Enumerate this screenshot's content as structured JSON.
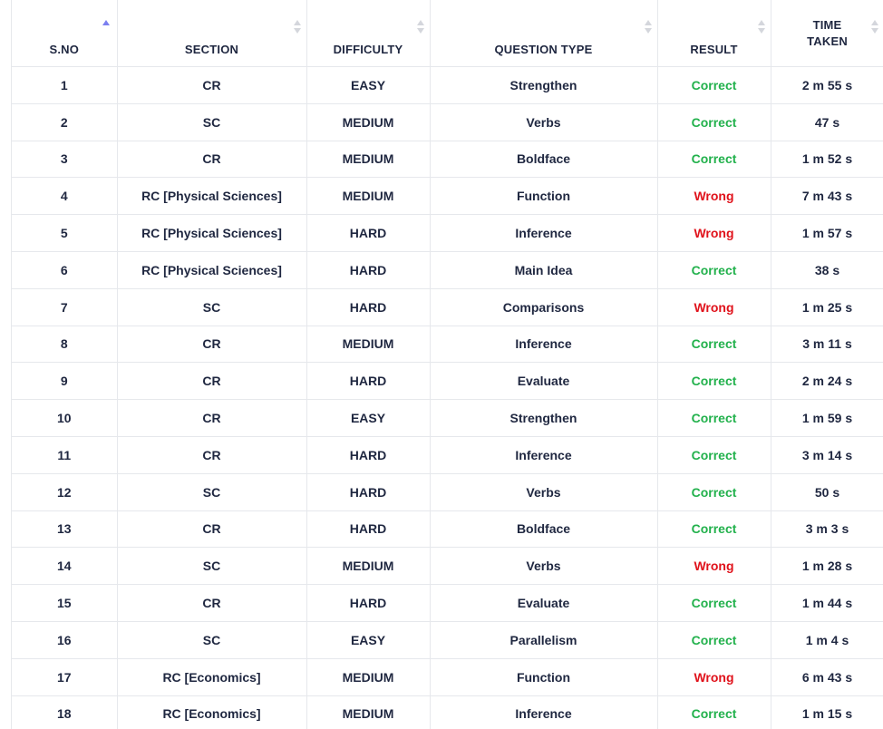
{
  "table": {
    "headers": {
      "sno": "S.NO",
      "section": "SECTION",
      "difficulty": "DIFFICULTY",
      "question_type": "QUESTION TYPE",
      "result": "RESULT",
      "time_line1": "TIME",
      "time_line2": "TAKEN"
    },
    "sort": {
      "column": "sno",
      "direction": "ascending"
    },
    "colors": {
      "correct": "#22b14c",
      "wrong": "#e0121b",
      "sort_active": "#7b7ff0"
    },
    "rows": [
      {
        "sno": "1",
        "section": "CR",
        "difficulty": "EASY",
        "qtype": "Strengthen",
        "result": "Correct",
        "time": "2 m 55 s"
      },
      {
        "sno": "2",
        "section": "SC",
        "difficulty": "MEDIUM",
        "qtype": "Verbs",
        "result": "Correct",
        "time": "47 s"
      },
      {
        "sno": "3",
        "section": "CR",
        "difficulty": "MEDIUM",
        "qtype": "Boldface",
        "result": "Correct",
        "time": "1 m 52 s"
      },
      {
        "sno": "4",
        "section": "RC [Physical Sciences]",
        "difficulty": "MEDIUM",
        "qtype": "Function",
        "result": "Wrong",
        "time": "7 m 43 s"
      },
      {
        "sno": "5",
        "section": "RC [Physical Sciences]",
        "difficulty": "HARD",
        "qtype": "Inference",
        "result": "Wrong",
        "time": "1 m 57 s"
      },
      {
        "sno": "6",
        "section": "RC [Physical Sciences]",
        "difficulty": "HARD",
        "qtype": "Main Idea",
        "result": "Correct",
        "time": "38 s"
      },
      {
        "sno": "7",
        "section": "SC",
        "difficulty": "HARD",
        "qtype": "Comparisons",
        "result": "Wrong",
        "time": "1 m 25 s"
      },
      {
        "sno": "8",
        "section": "CR",
        "difficulty": "MEDIUM",
        "qtype": "Inference",
        "result": "Correct",
        "time": "3 m 11 s"
      },
      {
        "sno": "9",
        "section": "CR",
        "difficulty": "HARD",
        "qtype": "Evaluate",
        "result": "Correct",
        "time": "2 m 24 s"
      },
      {
        "sno": "10",
        "section": "CR",
        "difficulty": "EASY",
        "qtype": "Strengthen",
        "result": "Correct",
        "time": "1 m 59 s"
      },
      {
        "sno": "11",
        "section": "CR",
        "difficulty": "HARD",
        "qtype": "Inference",
        "result": "Correct",
        "time": "3 m 14 s"
      },
      {
        "sno": "12",
        "section": "SC",
        "difficulty": "HARD",
        "qtype": "Verbs",
        "result": "Correct",
        "time": "50 s"
      },
      {
        "sno": "13",
        "section": "CR",
        "difficulty": "HARD",
        "qtype": "Boldface",
        "result": "Correct",
        "time": "3 m 3 s"
      },
      {
        "sno": "14",
        "section": "SC",
        "difficulty": "MEDIUM",
        "qtype": "Verbs",
        "result": "Wrong",
        "time": "1 m 28 s"
      },
      {
        "sno": "15",
        "section": "CR",
        "difficulty": "HARD",
        "qtype": "Evaluate",
        "result": "Correct",
        "time": "1 m 44 s"
      },
      {
        "sno": "16",
        "section": "SC",
        "difficulty": "EASY",
        "qtype": "Parallelism",
        "result": "Correct",
        "time": "1 m 4 s"
      },
      {
        "sno": "17",
        "section": "RC [Economics]",
        "difficulty": "MEDIUM",
        "qtype": "Function",
        "result": "Wrong",
        "time": "6 m 43 s"
      },
      {
        "sno": "18",
        "section": "RC [Economics]",
        "difficulty": "MEDIUM",
        "qtype": "Inference",
        "result": "Correct",
        "time": "1 m 15 s"
      }
    ]
  }
}
